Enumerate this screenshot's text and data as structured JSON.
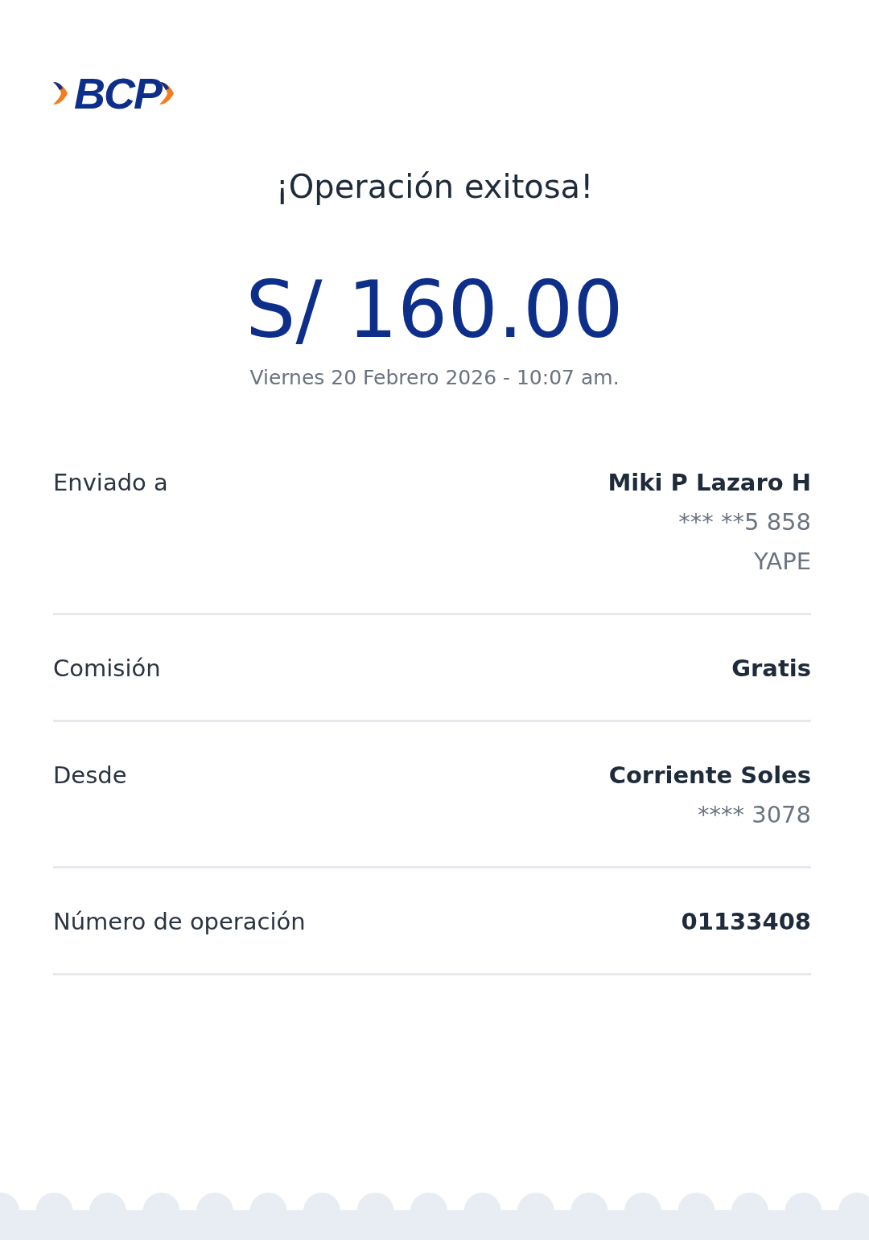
{
  "logo": {
    "text": "BCP"
  },
  "title": "¡Operación exitosa!",
  "amount": "S/ 160.00",
  "datetime": "Viernes 20 Febrero 2026 - 10:07 am.",
  "details": [
    {
      "label": "Enviado a",
      "values": [
        {
          "text": "Miki P Lazaro H",
          "kind": "primary"
        },
        {
          "text": "*** **5 858",
          "kind": "secondary"
        },
        {
          "text": "YAPE",
          "kind": "secondary"
        }
      ]
    },
    {
      "label": "Comisión",
      "values": [
        {
          "text": "Gratis",
          "kind": "primary"
        }
      ]
    },
    {
      "label": "Desde",
      "values": [
        {
          "text": "Corriente Soles",
          "kind": "primary"
        },
        {
          "text": "**** 3078",
          "kind": "secondary"
        }
      ]
    },
    {
      "label": "Número de operación",
      "values": [
        {
          "text": "01133408",
          "kind": "primary"
        }
      ]
    }
  ]
}
